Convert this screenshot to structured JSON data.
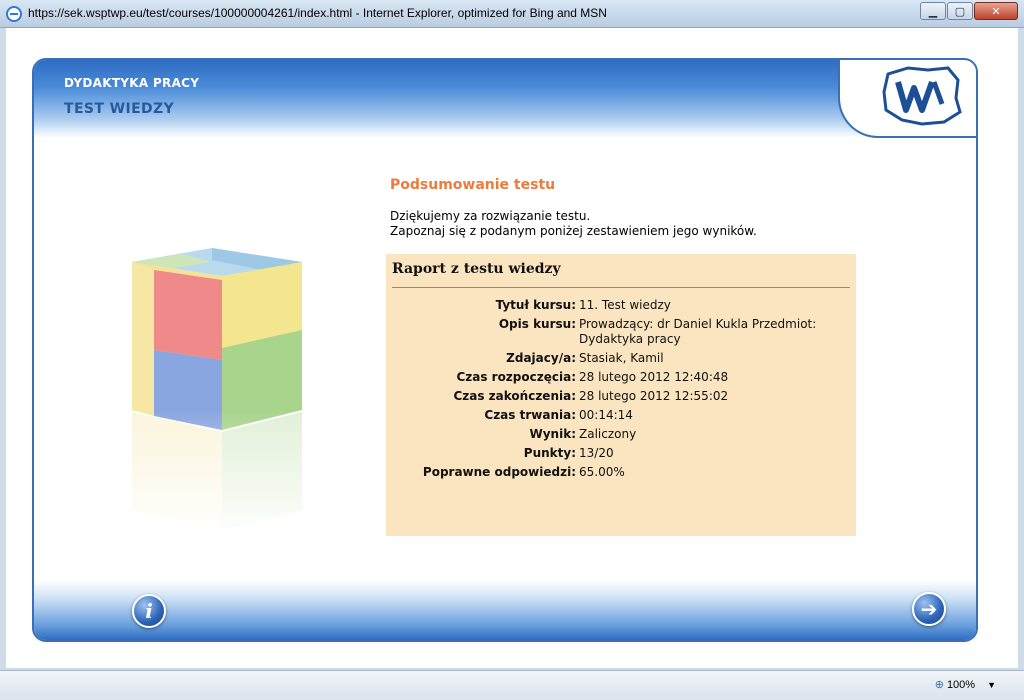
{
  "window": {
    "title": "https://sek.wsptwp.eu/test/courses/100000004261/index.html - Internet Explorer, optimized for Bing and MSN",
    "minimize": "▁",
    "maximize": "▢",
    "close": "✕"
  },
  "header": {
    "course": "DYDAKTYKA PRACY",
    "test": "TEST WIEDZY"
  },
  "summary": {
    "title": "Podsumowanie testu",
    "line1": "Dziękujemy za rozwiązanie testu.",
    "line2": "Zapoznaj się z podanym poniżej zestawieniem jego wyników."
  },
  "report": {
    "title": "Raport z testu wiedzy",
    "rows": [
      {
        "label": "Tytuł kursu:",
        "value": "11. Test wiedzy"
      },
      {
        "label": "Opis kursu:",
        "value": "Prowadzący: dr Daniel Kukla Przedmiot: Dydaktyka pracy"
      },
      {
        "label": "Zdajacy/a:",
        "value": "Stasiak, Kamil"
      },
      {
        "label": "Czas rozpoczęcia:",
        "value": "28 lutego 2012 12:40:48"
      },
      {
        "label": "Czas zakończenia:",
        "value": "28 lutego 2012 12:55:02"
      },
      {
        "label": "Czas trwania:",
        "value": "00:14:14"
      },
      {
        "label": "Wynik:",
        "value": "Zaliczony"
      },
      {
        "label": "Punkty:",
        "value": "13/20"
      },
      {
        "label": "Poprawne odpowiedzi:",
        "value": "65.00%"
      }
    ]
  },
  "footer": {
    "info_label": "i",
    "next_label": "➔"
  },
  "status": {
    "zoom": "100%"
  },
  "icons": {
    "browser": "ie-icon",
    "info": "info-icon",
    "next": "arrow-right-icon",
    "zoom": "zoom-icon",
    "logo": "wsptwp-logo"
  },
  "colors": {
    "frame_border": "#3a6fb5",
    "summary_title": "#f07a3c",
    "report_bg": "#fae5c0",
    "header_blue": "#2559a0"
  }
}
